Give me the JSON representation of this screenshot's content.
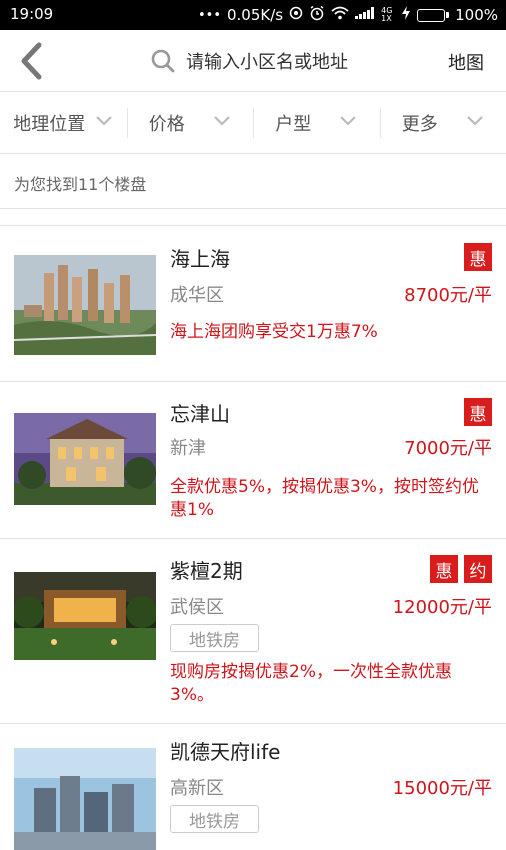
{
  "status_bar": {
    "time": "19:09",
    "network_speed": "0.05K/s",
    "signal_label": "4G 1X",
    "battery": "100%",
    "battery_level": 1.0
  },
  "header": {
    "back_icon": "chevron-left-icon",
    "search_icon": "search-icon",
    "search_placeholder": "请输入小区名或地址",
    "map_label": "地图"
  },
  "filters": [
    {
      "label": "地理位置"
    },
    {
      "label": "价格"
    },
    {
      "label": "户型"
    },
    {
      "label": "更多"
    }
  ],
  "result_count": "为您找到11个楼盘",
  "colors": {
    "accent": "#d0141b",
    "badge": "#d91c1c"
  },
  "listings": [
    {
      "name": "海上海",
      "district": "成华区",
      "price": "8700元/平",
      "badges": [
        "惠"
      ],
      "tags": [],
      "promo": "海上海团购享受交1万惠7%"
    },
    {
      "name": "忘津山",
      "district": "新津",
      "price": "7000元/平",
      "badges": [
        "惠"
      ],
      "tags": [],
      "promo": "全款优惠5%，按揭优惠3%，按时签约优惠1%"
    },
    {
      "name": "紫檀2期",
      "district": "武侯区",
      "price": "12000元/平",
      "badges": [
        "惠",
        "约"
      ],
      "tags": [
        "地铁房"
      ],
      "promo": "现购房按揭优惠2%，一次性全款优惠3%。"
    },
    {
      "name": "凯德天府life",
      "district": "高新区",
      "price": "15000元/平",
      "badges": [],
      "tags": [
        "地铁房"
      ],
      "promo": ""
    }
  ]
}
